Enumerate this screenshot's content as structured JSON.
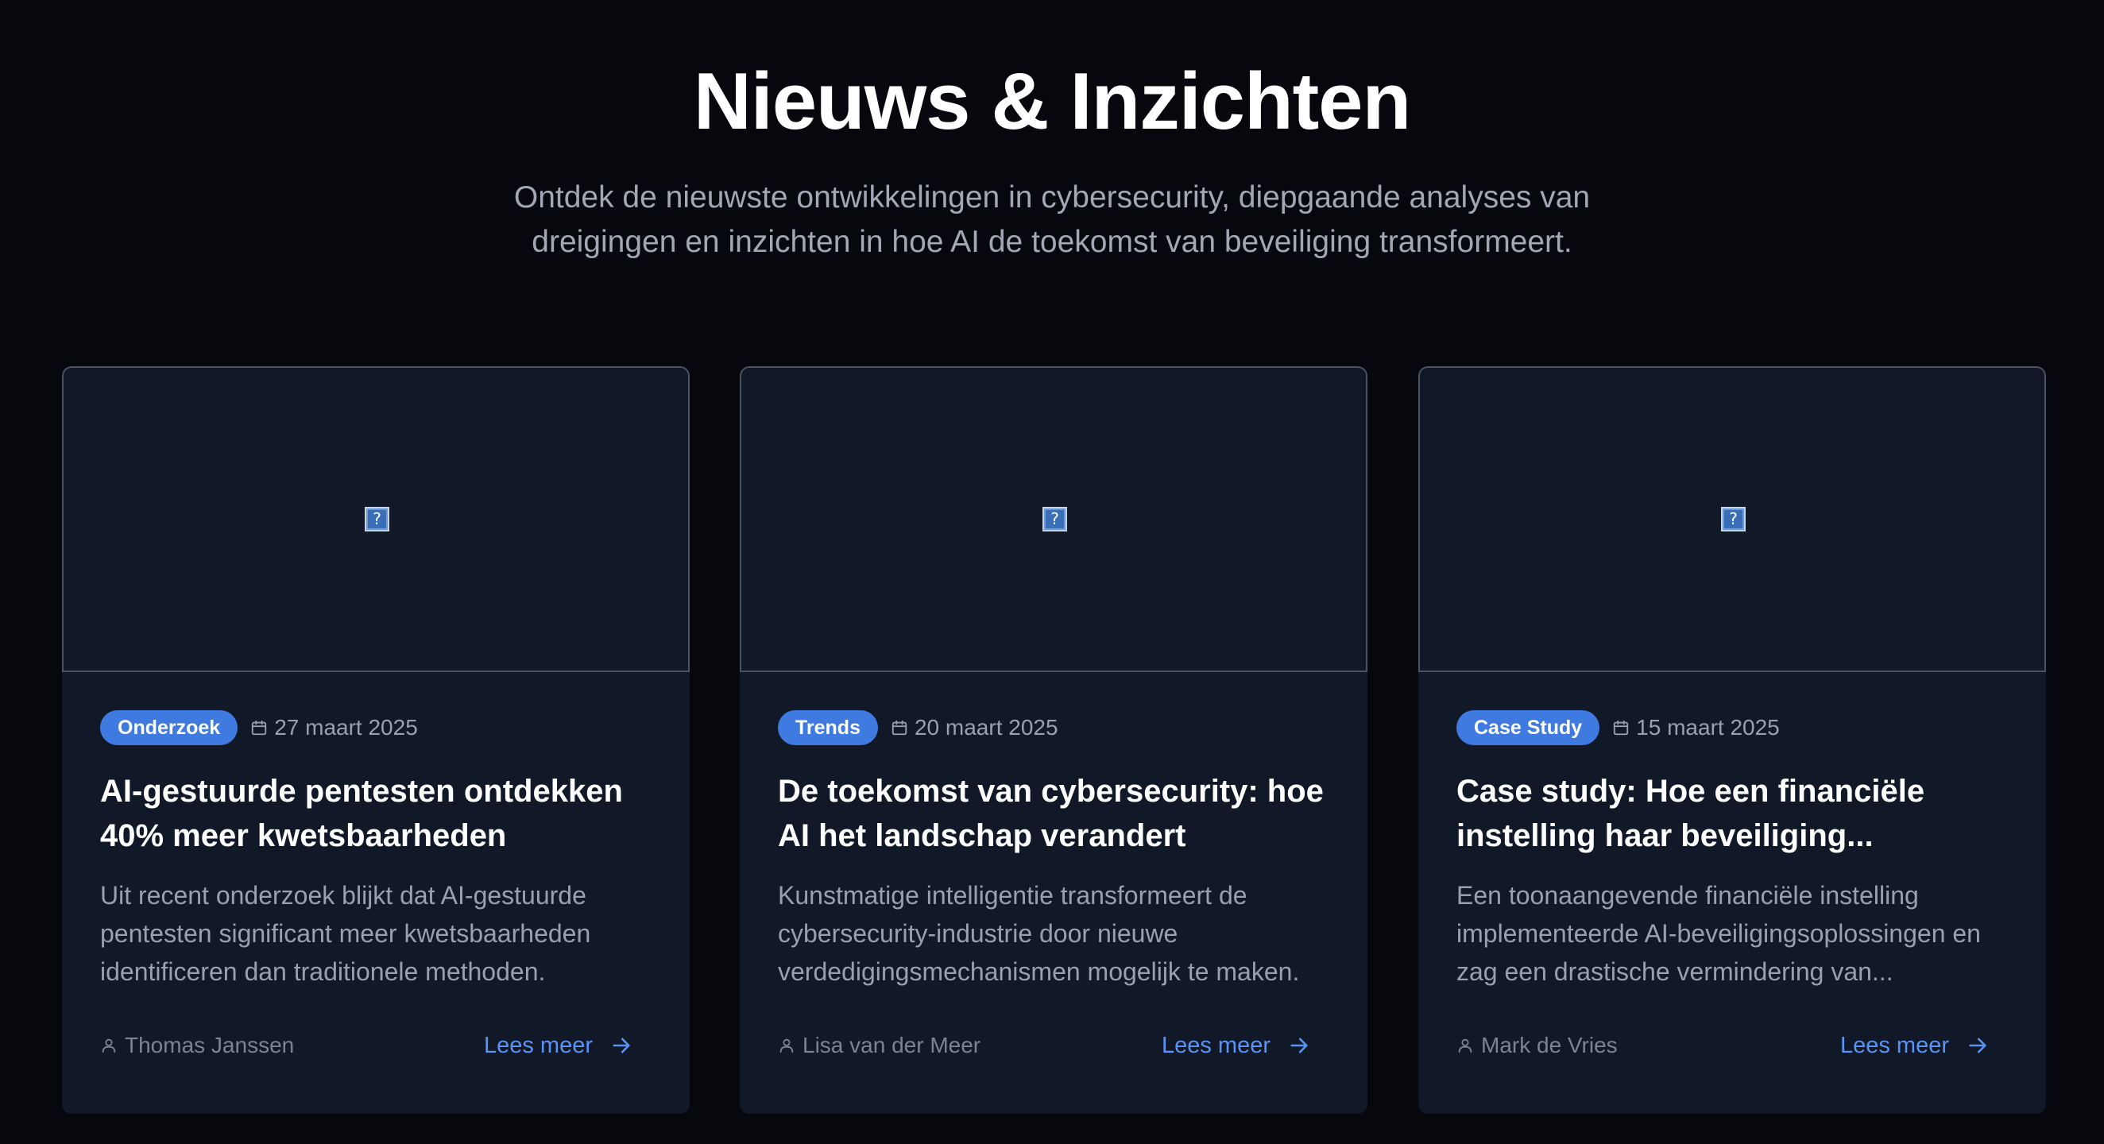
{
  "header": {
    "title": "Nieuws & Inzichten",
    "subtitle": "Ontdek de nieuwste ontwikkelingen in cybersecurity, diepgaande analyses van dreigingen en inzichten in hoe AI de toekomst van beveiliging transformeert."
  },
  "colors": {
    "background": "#06080d",
    "card_background": "#111827",
    "tag_background": "#3f7ae0",
    "link": "#5b93f5",
    "muted_text": "#9aa1ad"
  },
  "articles": [
    {
      "image_icon": "broken-image-icon",
      "tag": "Onderzoek",
      "date": "27 maart 2025",
      "title": "AI-gestuurde pentesten ontdekken 40% meer kwetsbaarheden",
      "excerpt": "Uit recent onderzoek blijkt dat AI-gestuurde pentesten significant meer kwetsbaarheden identificeren dan traditionele methoden.",
      "author": "Thomas Janssen",
      "cta": "Lees meer"
    },
    {
      "image_icon": "broken-image-icon",
      "tag": "Trends",
      "date": "20 maart 2025",
      "title": "De toekomst van cybersecurity: hoe AI het landschap verandert",
      "excerpt": "Kunstmatige intelligentie transformeert de cybersecurity-industrie door nieuwe verdedigingsmechanismen mogelijk te maken.",
      "author": "Lisa van der Meer",
      "cta": "Lees meer"
    },
    {
      "image_icon": "broken-image-icon",
      "tag": "Case Study",
      "date": "15 maart 2025",
      "title": "Case study: Hoe een financiële instelling haar beveiliging...",
      "excerpt": "Een toonaangevende financiële instelling implementeerde AI-beveiligingsoplossingen en zag een drastische vermindering van...",
      "author": "Mark de Vries",
      "cta": "Lees meer"
    }
  ]
}
